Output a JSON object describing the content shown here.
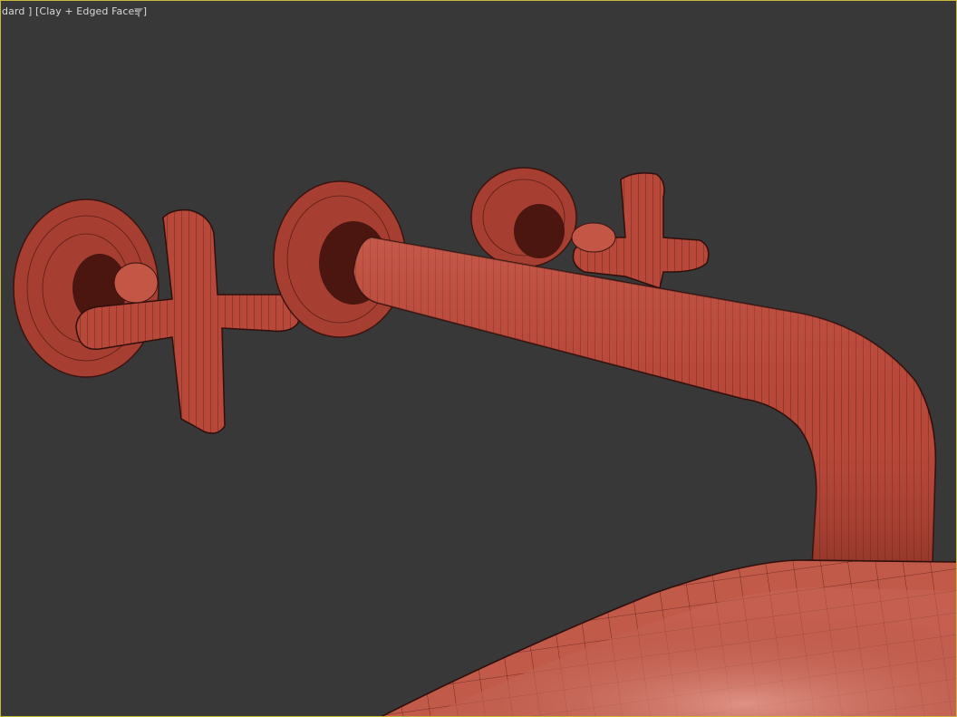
{
  "viewport": {
    "label": "dard ] [Clay + Edged Faces ]",
    "filter_icon": "filter-icon",
    "accent_border": "#c8b93a",
    "background": "#383838"
  },
  "scene": {
    "material_color": "#b94a3a",
    "edge_color": "#3a1410",
    "objects": [
      "left-handle-cross",
      "left-rosette",
      "spout-rosette",
      "spout-pipe",
      "right-rosette",
      "right-handle-cross",
      "basin"
    ]
  }
}
